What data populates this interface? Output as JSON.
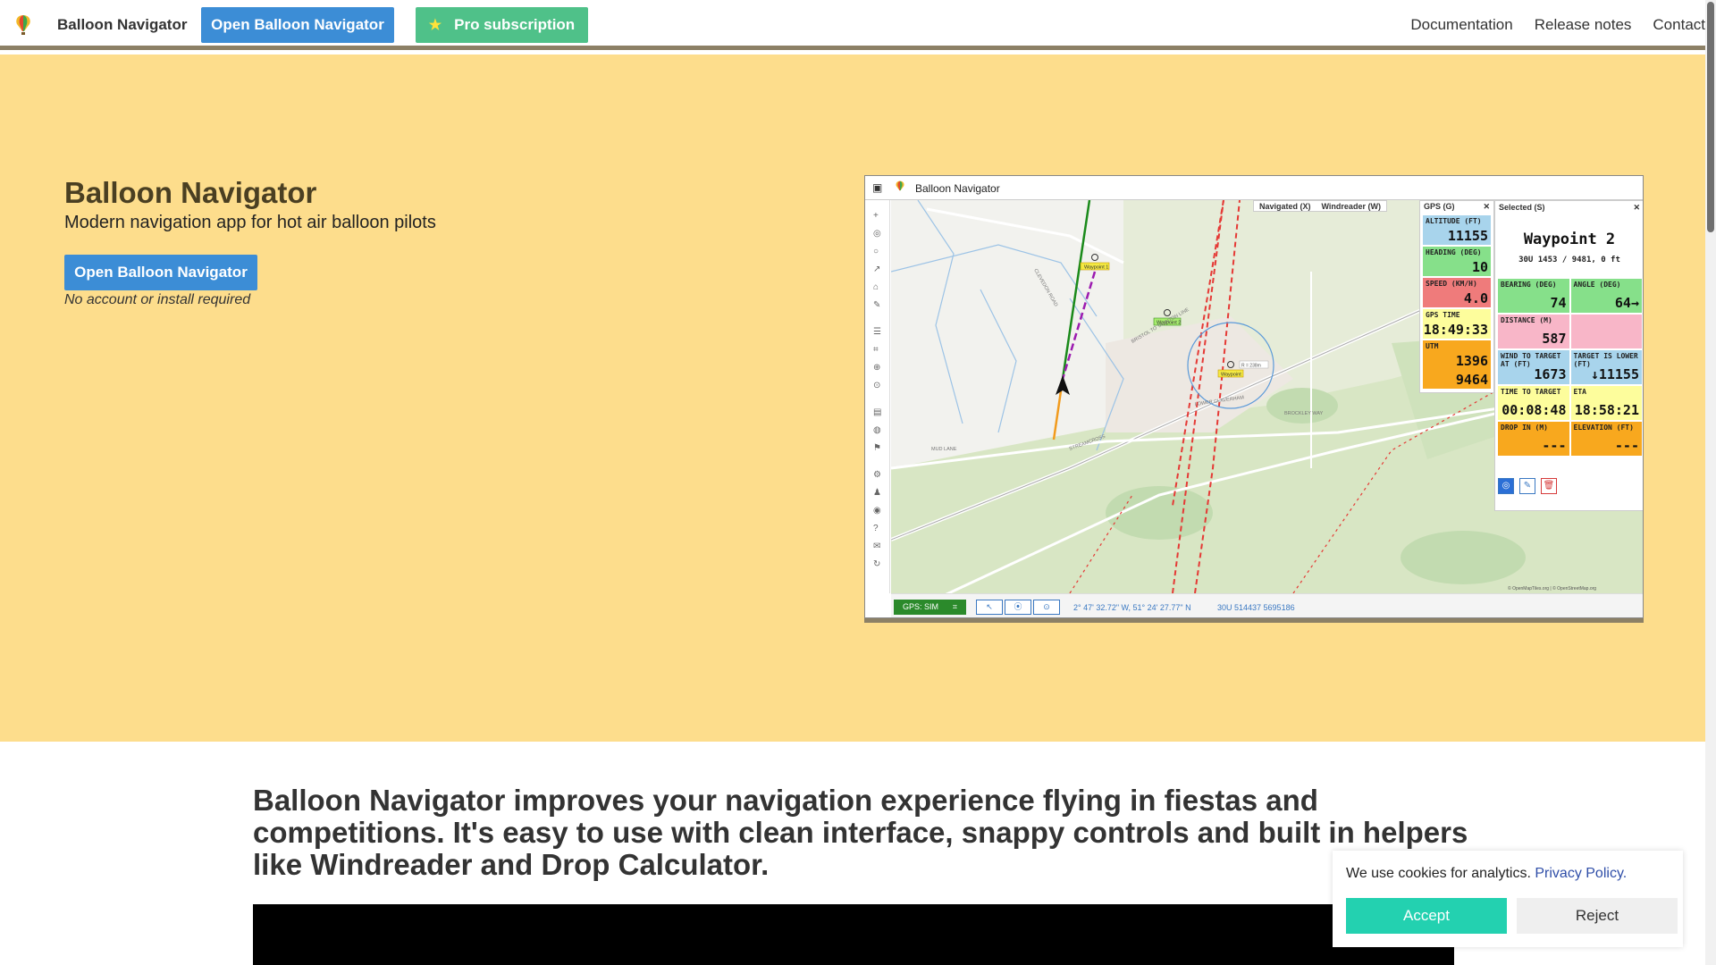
{
  "navbar": {
    "brand": "Balloon Navigator",
    "open_button": "Open Balloon Navigator",
    "pro_button": "Pro subscription",
    "links": [
      "Documentation",
      "Release notes",
      "Contact"
    ]
  },
  "hero": {
    "title": "Balloon Navigator",
    "subtitle": "Modern navigation app for hot air balloon pilots",
    "open_button": "Open Balloon Navigator",
    "note": "No account or install required"
  },
  "preview": {
    "window_title": "Balloon Navigator",
    "tabs": [
      "Navigated (X)",
      "Windreader (W)"
    ],
    "gps_panel": {
      "title": "GPS (G)",
      "cells": [
        {
          "label": "ALTITUDE (FT)",
          "value": "11155",
          "color": "#a8d4ec"
        },
        {
          "label": "HEADING (DEG)",
          "value": "10",
          "color": "#86e08a"
        },
        {
          "label": "SPEED (KM/H)",
          "value": "4.0",
          "color": "#ef7b7b"
        },
        {
          "label": "GPS TIME",
          "value": "18:49:33",
          "color": "#fdfd9c"
        },
        {
          "label": "UTM",
          "value": "1396",
          "value2": "9464",
          "color": "#f8a81e"
        }
      ]
    },
    "selected_panel": {
      "title": "Selected (S)",
      "name": "Waypoint 2",
      "utm": "30U 1453 / 9481, 0 ft",
      "rows": [
        [
          {
            "label": "BEARING (DEG)",
            "value": "74",
            "color": "#86e08a"
          },
          {
            "label": "ANGLE (DEG)",
            "value": "64→",
            "color": "#86e08a"
          }
        ],
        [
          {
            "label": "DISTANCE (M)",
            "value": "587",
            "color": "#f8b6c8"
          },
          {
            "label": "",
            "value": "",
            "color": "#f8b6c8"
          }
        ],
        [
          {
            "label": "WIND TO TARGET AT (FT)",
            "value": "1673",
            "color": "#a8d4ec"
          },
          {
            "label": "TARGET IS LOWER (FT)",
            "value": "↓11155",
            "color": "#a8d4ec"
          }
        ],
        [
          {
            "label": "TIME TO TARGET",
            "value": "00:08:48",
            "color": "#fdfd9c"
          },
          {
            "label": "ETA",
            "value": "18:58:21",
            "color": "#fdfd9c"
          }
        ],
        [
          {
            "label": "DROP IN (M)",
            "value": "---",
            "color": "#f8a81e"
          },
          {
            "label": "ELEVATION (FT)",
            "value": "---",
            "color": "#f8a81e"
          }
        ]
      ]
    },
    "map_labels": {
      "road1": "CLEVEDON ROAD",
      "road2": "BRISTOL TO TAUNTON LINE",
      "road3": "LOWER CLAVERHAM",
      "road4": "BROCKLEY WAY",
      "road5": "MUD LANE",
      "road6": "STREAMCROSS",
      "wp1": "Waypoint 1",
      "wp2": "Waypoint 2",
      "wp3": "Waypoint",
      "radius": "R = 238m",
      "attribution": "© OpenMapTiles.org | © OpenStreetMap.org"
    },
    "bottom": {
      "gps_sim": "GPS: SIM",
      "coords": "2° 47' 32.72\" W, 51° 24' 27.77\" N",
      "utm": "30U 514437 5695186"
    }
  },
  "content": {
    "title": "Balloon Navigator improves your navigation experience flying in fiestas and competitions. It's easy to use with clean interface, snappy controls and built in helpers like Windreader and Drop Calculator."
  },
  "cookie": {
    "text": "We use cookies for analytics.",
    "link": "Privacy Policy.",
    "accept": "Accept",
    "reject": "Reject"
  }
}
